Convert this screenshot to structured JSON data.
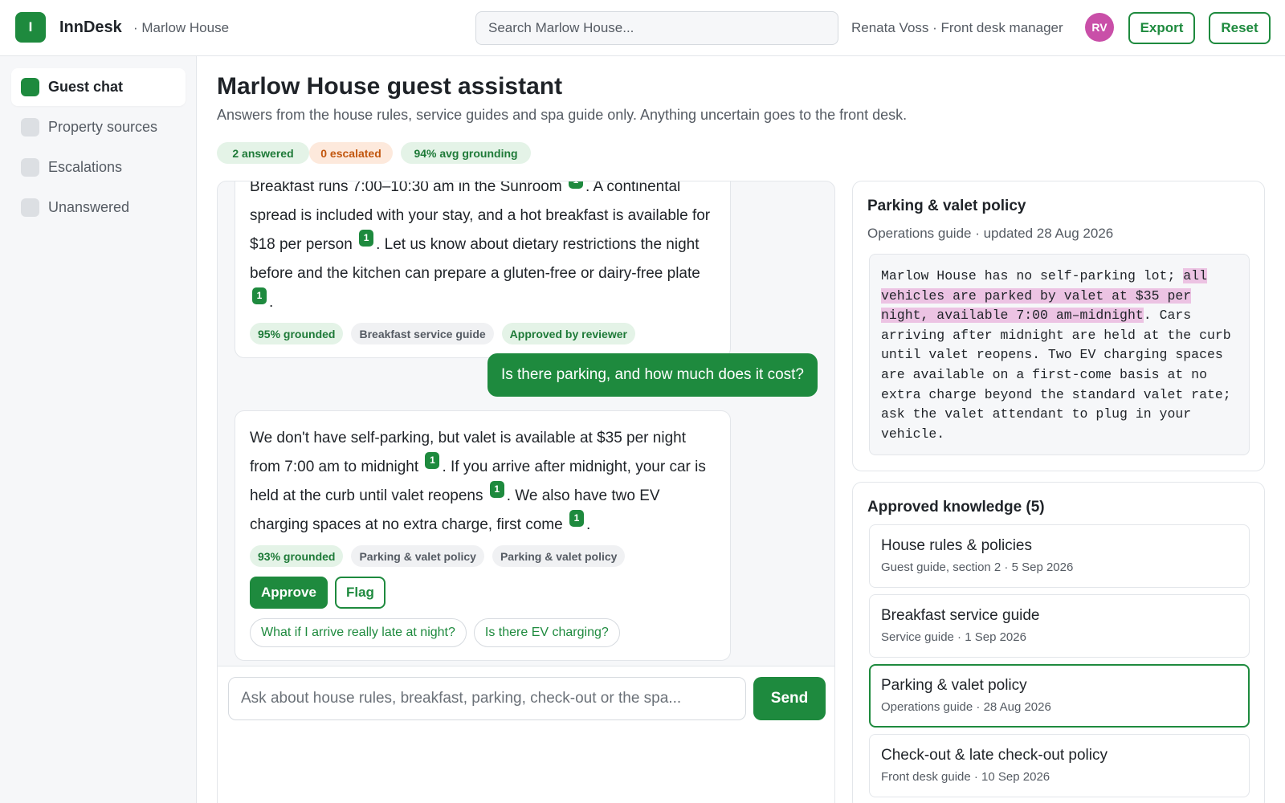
{
  "app": {
    "logo_letter": "I",
    "name": "InnDesk",
    "property": "· Marlow House"
  },
  "header": {
    "search_placeholder": "Search Marlow House...",
    "user": "Renata Voss · Front desk manager",
    "avatar_initials": "RV",
    "export_label": "Export",
    "reset_label": "Reset"
  },
  "sidebar": {
    "items": [
      {
        "label": "Guest chat",
        "active": true
      },
      {
        "label": "Property sources",
        "active": false
      },
      {
        "label": "Escalations",
        "active": false
      },
      {
        "label": "Unanswered",
        "active": false
      }
    ]
  },
  "page": {
    "title": "Marlow House guest assistant",
    "subtitle": "Answers from the house rules, service guides and spa guide only. Anything uncertain goes to the front desk.",
    "stats": {
      "answered": "2 answered",
      "escalated": "0 escalated",
      "grounding": "94% avg grounding"
    }
  },
  "chat": {
    "messages": [
      {
        "role": "assistant",
        "segments": [
          "Breakfast runs 7:00–10:30 am in the Sunroom",
          ". A continental spread is included with your stay, and a hot breakfast is available for $18 per person",
          ". Let us know about dietary restrictions the night before and the kitchen can prepare a gluten-free or dairy-free plate",
          "."
        ],
        "citation": "1",
        "grounded": "95% grounded",
        "source": "Breakfast service guide",
        "status": "Approved by reviewer"
      },
      {
        "role": "user",
        "text": "Is there parking, and how much does it cost?"
      },
      {
        "role": "assistant",
        "segments": [
          "We don't have self-parking, but valet is available at $35 per night from 7:00 am to midnight",
          ". If you arrive after midnight, your car is held at the curb until valet reopens",
          ". We also have two EV charging spaces at no extra charge, first come",
          "."
        ],
        "citation": "1",
        "grounded": "93% grounded",
        "sources": [
          "Parking & valet policy",
          "Parking & valet policy"
        ],
        "approve_label": "Approve",
        "flag_label": "Flag",
        "suggestions": [
          "What if I arrive really late at night?",
          "Is there EV charging?"
        ]
      }
    ],
    "composer_placeholder": "Ask about house rules, breakfast, parking, check-out or the spa...",
    "send_label": "Send"
  },
  "source_panel": {
    "title": "Parking & valet policy",
    "meta": "Operations guide · updated 28 Aug 2026",
    "text_before": "Marlow House has no self-parking lot; ",
    "text_highlight": "all vehicles are parked by valet at $35 per night, available 7:00 am–midnight",
    "text_after": ". Cars arriving after midnight are held at the curb until valet reopens. Two EV charging spaces are available on a first-come basis at no extra charge beyond the standard valet rate; ask the valet attendant to plug in your vehicle.",
    "highlight_color": "#ecc3e3"
  },
  "knowledge": {
    "title": "Approved knowledge (5)",
    "items": [
      {
        "title": "House rules & policies",
        "meta": "Guest guide, section 2 · 5 Sep 2026",
        "active": false
      },
      {
        "title": "Breakfast service guide",
        "meta": "Service guide · 1 Sep 2026",
        "active": false
      },
      {
        "title": "Parking & valet policy",
        "meta": "Operations guide · 28 Aug 2026",
        "active": true
      },
      {
        "title": "Check-out & late check-out policy",
        "meta": "Front desk guide · 10 Sep 2026",
        "active": false
      }
    ]
  },
  "colors": {
    "accent": "#1e8a3e",
    "avatar": "#c94fa8",
    "escalated": "#c2570f"
  }
}
